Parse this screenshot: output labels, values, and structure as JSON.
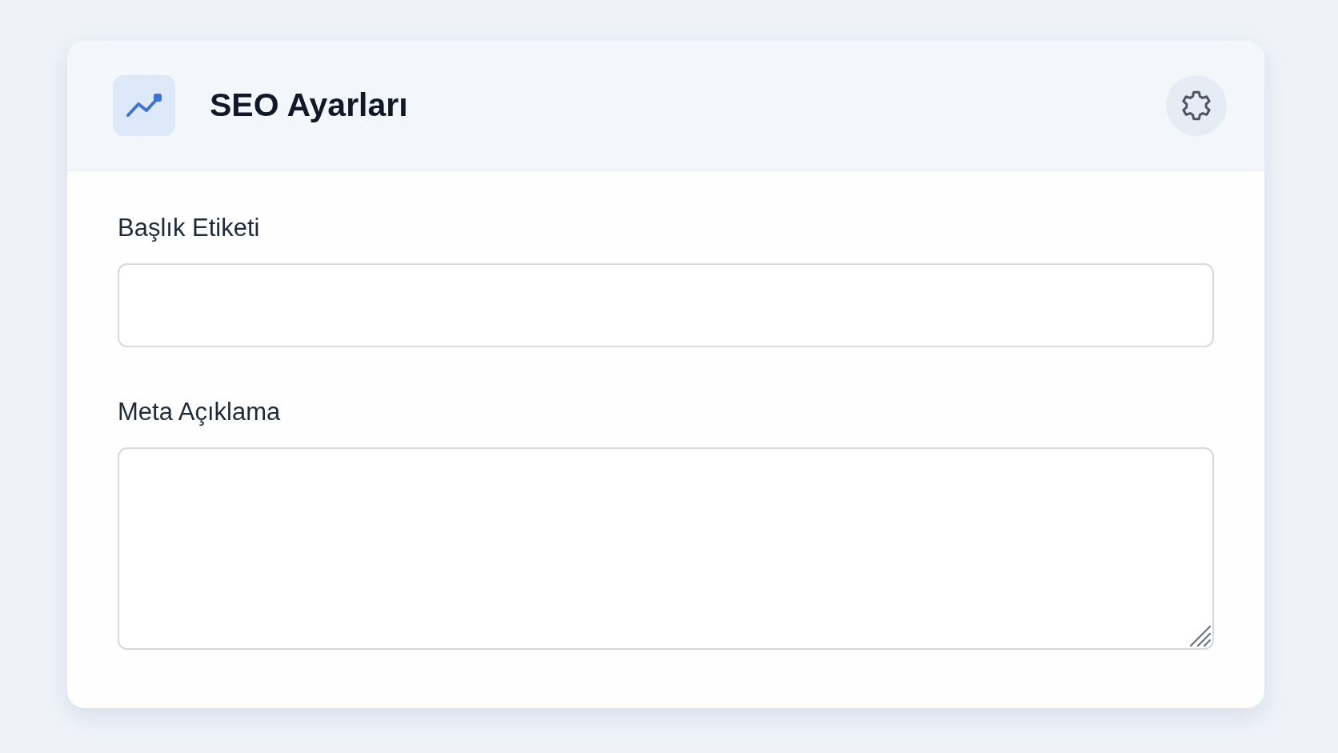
{
  "header": {
    "title": "SEO Ayarları"
  },
  "fields": [
    {
      "kind": "input",
      "label": "Başlık Etiketi"
    },
    {
      "kind": "textarea",
      "label": "Meta Açıklama"
    }
  ]
}
